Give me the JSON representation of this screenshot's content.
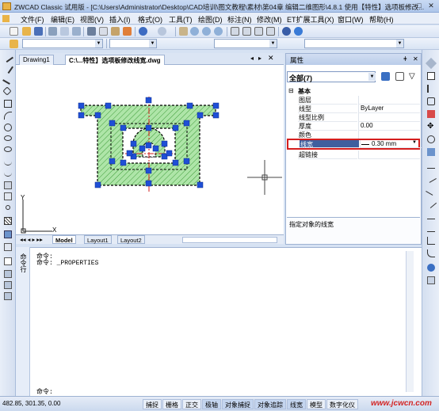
{
  "title": "ZWCAD Classic 试用版 - [C:\\Users\\Administrator\\Desktop\\CAD培训\\图文教程\\素材\\第04章 编辑二维图形\\4.8.1 使用【特性】选项板修改...",
  "menu": [
    "文件(F)",
    "编辑(E)",
    "视图(V)",
    "插入(I)",
    "格式(O)",
    "工具(T)",
    "绘图(D)",
    "标注(N)",
    "修改(M)",
    "ET扩展工具(X)",
    "窗口(W)",
    "帮助(H)"
  ],
  "tabs": {
    "t1": "Drawing1",
    "t2": "C:\\...特性】选项板修改线宽.dwg"
  },
  "layout_tabs": {
    "model": "Model",
    "l1": "Layout1",
    "l2": "Layout2"
  },
  "ucs": {
    "x": "X",
    "y": "Y"
  },
  "props": {
    "title": "属性",
    "selection": "全部(7)",
    "group": "基本",
    "rows": [
      {
        "k": "图层",
        "v": ""
      },
      {
        "k": "线型",
        "v": "ByLayer"
      },
      {
        "k": "线型比例",
        "v": ""
      },
      {
        "k": "厚度",
        "v": "0.00"
      },
      {
        "k": "颜色",
        "v": ""
      },
      {
        "k": "线宽",
        "v": "0.30 mm"
      },
      {
        "k": "超链接",
        "v": ""
      }
    ],
    "description": "指定对象的线宽"
  },
  "cmd": {
    "grip": "命令行",
    "l1": "命令:",
    "l2": "命令: _PROPERTIES",
    "prompt": "命令:"
  },
  "status": {
    "coords": "482.85, 301.35, 0.00",
    "buttons": [
      "捕捉",
      "栅格",
      "正交",
      "极轴",
      "对象捕捉",
      "对象追踪",
      "线宽",
      "模型",
      "数字化仪"
    ]
  },
  "watermark": "www.jcwcn.com",
  "colors": {
    "hatch": "#aee5a8",
    "grip": "#1f4fd6",
    "accent": "#c8d8f0",
    "highlight": "#3f5f9e"
  }
}
